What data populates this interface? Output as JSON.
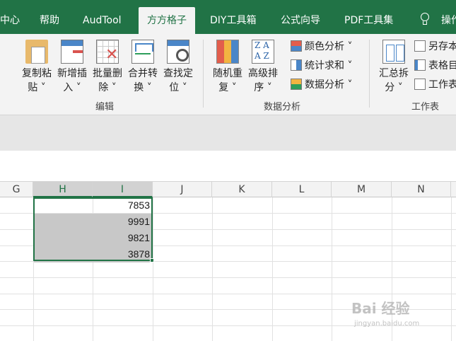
{
  "tabs": [
    {
      "label": "中心"
    },
    {
      "label": "帮助"
    },
    {
      "label": "AudTool"
    },
    {
      "label": "方方格子"
    },
    {
      "label": "DIY工具箱"
    },
    {
      "label": "公式向导"
    },
    {
      "label": "PDF工具集"
    },
    {
      "label": "操作"
    }
  ],
  "active_tab": "方方格子",
  "ribbon": {
    "group_edit": {
      "label": "编辑",
      "buttons": [
        {
          "line1": "复制粘",
          "line2": "贴 ˅",
          "icon": "clipboard-paste-icon"
        },
        {
          "line1": "新增插",
          "line2": "入 ˅",
          "icon": "insert-row-icon"
        },
        {
          "line1": "批量删",
          "line2": "除 ˅",
          "icon": "batch-delete-icon"
        },
        {
          "line1": "合并转",
          "line2": "换 ˅",
          "icon": "merge-convert-icon"
        },
        {
          "line1": "查找定",
          "line2": "位 ˅",
          "icon": "find-locate-icon"
        }
      ]
    },
    "group_analysis": {
      "label": "数据分析",
      "buttons": [
        {
          "line1": "随机重",
          "line2": "复 ˅",
          "icon": "random-repeat-icon"
        },
        {
          "line1": "高级排",
          "line2": "序 ˅",
          "icon": "sort-az-icon"
        }
      ],
      "small": [
        {
          "label": "颜色分析 ˅",
          "icon": "color-analysis-icon"
        },
        {
          "label": "统计求和 ˅",
          "icon": "stats-sum-icon"
        },
        {
          "label": "数据分析 ˅",
          "icon": "data-analysis-icon"
        }
      ]
    },
    "group_sheet": {
      "label": "工作表",
      "buttons": [
        {
          "line1": "汇总拆",
          "line2": "分 ˅",
          "icon": "summary-split-icon"
        }
      ],
      "small": [
        {
          "label": "另存本",
          "icon": "save-as-icon"
        },
        {
          "label": "表格目",
          "icon": "table-index-icon"
        },
        {
          "label": "工作表",
          "icon": "worksheet-icon"
        }
      ]
    },
    "sort_icon_text": "Z A\nA Z"
  },
  "columns": [
    "G",
    "H",
    "I",
    "J",
    "K",
    "L",
    "M",
    "N"
  ],
  "selected_columns": [
    "H",
    "I"
  ],
  "cells": [
    {
      "col": "I",
      "value": "7853",
      "highlight": false
    },
    {
      "col": "I",
      "value": "9991",
      "highlight": true
    },
    {
      "col": "I",
      "value": "9821",
      "highlight": true
    },
    {
      "col": "I",
      "value": "3878",
      "highlight": true
    }
  ],
  "watermark": {
    "text": "Bai 经验",
    "sub": "jingyan.baidu.com"
  },
  "colors": {
    "accent": "#217346",
    "highlight": "#c8c8c8"
  }
}
